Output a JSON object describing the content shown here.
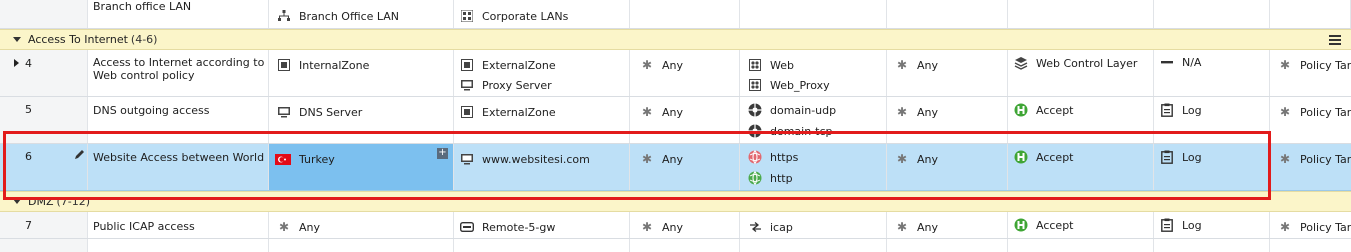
{
  "rows": {
    "top": {
      "name": "Branch office LAN",
      "source": "Branch Office LAN",
      "destination": "Corporate LANs"
    },
    "section_internet": {
      "title": "Access To Internet",
      "count": "(4-6)"
    },
    "rule4": {
      "num": "4",
      "name": "Access to Internet according to Web control policy",
      "source": "InternalZone",
      "destination": [
        "ExternalZone",
        "Proxy Server"
      ],
      "vpn": "Any",
      "services": [
        "Web",
        "Web_Proxy"
      ],
      "content": "Any",
      "action": "Web Control Layer",
      "track": "N/A",
      "install_on": "Policy Tar"
    },
    "rule5": {
      "num": "5",
      "name": "DNS outgoing access",
      "source": "DNS Server",
      "destination": "ExternalZone",
      "vpn": "Any",
      "services": [
        "domain-udp",
        "domain-tcp"
      ],
      "content": "Any",
      "action": "Accept",
      "track": "Log",
      "install_on": "Policy Tar"
    },
    "rule6": {
      "num": "6",
      "name": "Website Access between World",
      "source": "Turkey",
      "destination": "www.websitesi.com",
      "vpn": "Any",
      "services": [
        "https",
        "http"
      ],
      "content": "Any",
      "action": "Accept",
      "track": "Log",
      "install_on": "Policy Tar"
    },
    "section_dmz": {
      "title": "DMZ",
      "count": "(7-12)"
    },
    "rule7": {
      "num": "7",
      "name": "Public ICAP access",
      "source": "Any",
      "destination": "Remote-5-gw",
      "vpn": "Any",
      "services": [
        "icap"
      ],
      "content": "Any",
      "action": "Accept",
      "track": "Log",
      "install_on": "Policy Tar"
    }
  },
  "colors": {
    "selected_row": "#bde0f7",
    "selected_cell": "#7cc0ef",
    "section_bg": "#fbf5c9",
    "accept_green": "#3fa535",
    "highlight_border": "#e21b1b"
  }
}
